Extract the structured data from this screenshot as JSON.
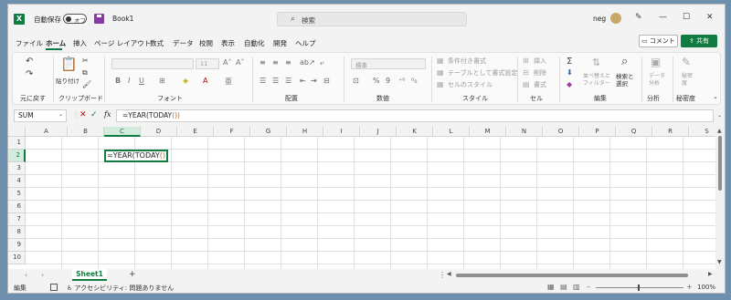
{
  "titlebar": {
    "app_logo": "X",
    "autosave_label": "自動保存",
    "autosave_state": "オフ",
    "title": "Book1",
    "search_placeholder": "検索",
    "username": "neg"
  },
  "menu": {
    "items": [
      "ファイル",
      "ホーム",
      "挿入",
      "ページ レイアウト",
      "数式",
      "データ",
      "校閲",
      "表示",
      "自動化",
      "開発",
      "ヘルプ"
    ],
    "active": "ホーム",
    "comment_label": "コメント",
    "share_label": "共有"
  },
  "ribbon": {
    "groups": [
      "元に戻す",
      "クリップボード",
      "フォント",
      "配置",
      "数値",
      "スタイル",
      "セル",
      "編集",
      "分析",
      "秘密度"
    ],
    "paste_label": "貼り付け",
    "font_name": "",
    "font_size": "11",
    "number_format": "標準",
    "conditional_format": "条件付き書式",
    "format_as_table": "テーブルとして書式設定",
    "cell_styles": "セルのスタイル",
    "insert": "挿入",
    "delete": "削除",
    "format": "書式",
    "sort_filter": "並べ替えと\nフィルター",
    "find_select": "検索と\n選択",
    "analyze_data": "データ\n分析",
    "sensitivity": "秘密\n度"
  },
  "formula_bar": {
    "name_box": "SUM",
    "formula_prefix": "=YEAR(TODAY",
    "formula_suffix": "())"
  },
  "grid": {
    "columns": [
      "A",
      "B",
      "C",
      "D",
      "E",
      "F",
      "G",
      "H",
      "I",
      "J",
      "K",
      "L",
      "M",
      "N",
      "O",
      "P",
      "Q",
      "R",
      "S"
    ],
    "rows": [
      "1",
      "2",
      "3",
      "4",
      "5",
      "6",
      "7",
      "8",
      "9",
      "10"
    ],
    "active_cell": "C2",
    "cell_text_prefix": "=YEAR(TODAY",
    "cell_text_suffix": "())"
  },
  "sheets": {
    "tabs": [
      "Sheet1"
    ],
    "active": "Sheet1"
  },
  "status": {
    "mode": "編集",
    "accessibility": "アクセシビリティ: 問題ありません",
    "zoom": "100%"
  }
}
